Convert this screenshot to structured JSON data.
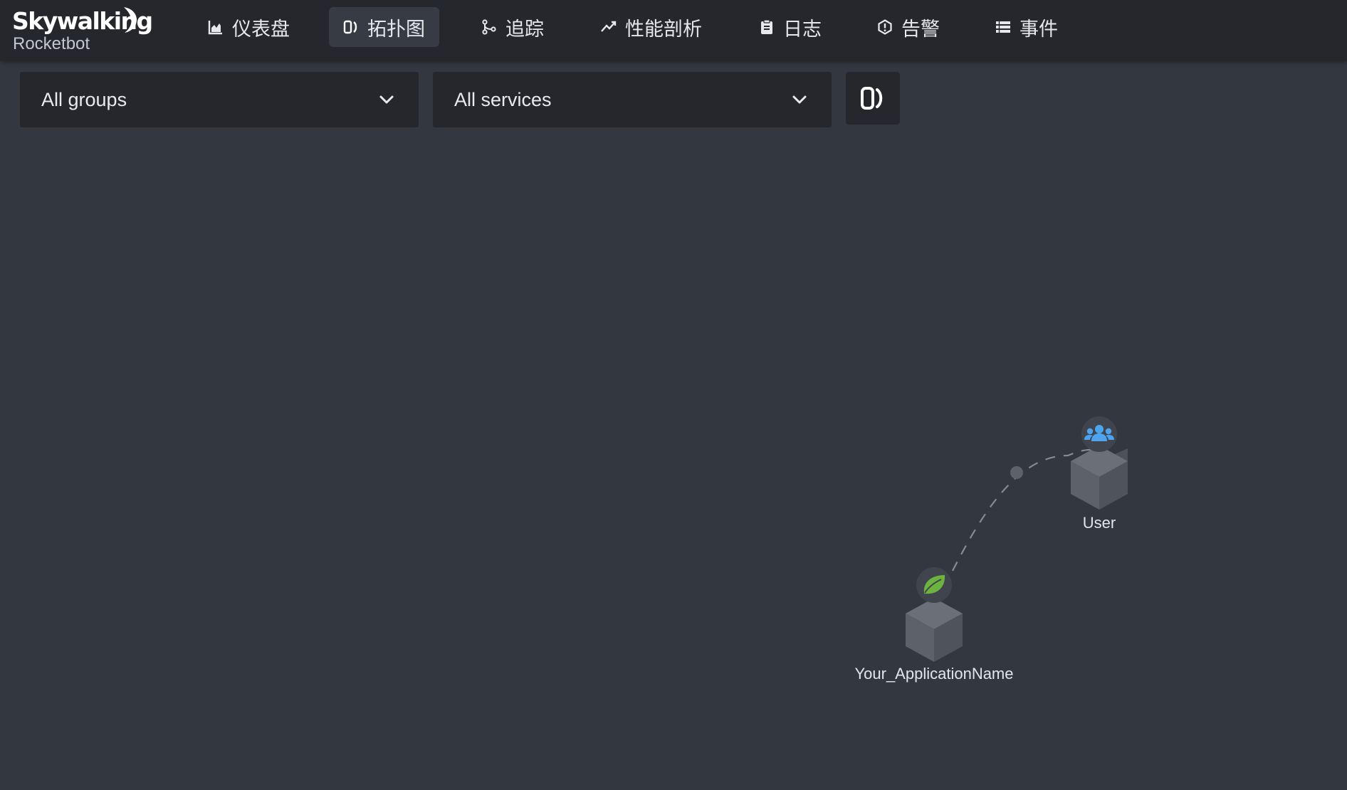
{
  "app": {
    "logo_main": "Skywalking",
    "logo_sub": "Rocketbot"
  },
  "nav": {
    "items": [
      {
        "label": "仪表盘",
        "icon": "chart-icon"
      },
      {
        "label": "拓扑图",
        "icon": "topology-icon",
        "active": true
      },
      {
        "label": "追踪",
        "icon": "trace-icon"
      },
      {
        "label": "性能剖析",
        "icon": "trend-icon"
      },
      {
        "label": "日志",
        "icon": "clipboard-icon"
      },
      {
        "label": "告警",
        "icon": "alert-icon"
      },
      {
        "label": "事件",
        "icon": "list-icon"
      }
    ]
  },
  "filters": {
    "group_select": {
      "value": "All groups"
    },
    "service_select": {
      "value": "All services"
    },
    "topology_button_icon": "topology-icon"
  },
  "topology": {
    "nodes": [
      {
        "name": "User",
        "icon": "users-icon",
        "icon_color": "#4ea3ee"
      },
      {
        "name": "Your_ApplicationName",
        "icon": "spring-leaf-icon",
        "icon_color": "#6db33f"
      }
    ],
    "links": [
      {
        "source": "User",
        "target": "Your_ApplicationName",
        "style": "dashed"
      }
    ]
  },
  "colors": {
    "background": "#333840",
    "topbar": "#25272d",
    "nav_active": "#363b44",
    "node_cube": "#5a5e68"
  }
}
